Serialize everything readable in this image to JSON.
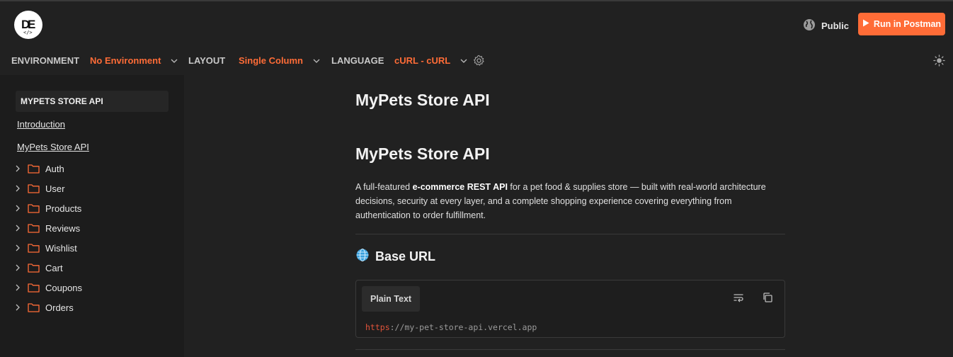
{
  "header": {
    "visibility_label": "Public",
    "run_button_label": "Run in Postman"
  },
  "toolbar": {
    "environment_label": "ENVIRONMENT",
    "environment_value": "No Environment",
    "layout_label": "LAYOUT",
    "layout_value": "Single Column",
    "language_label": "LANGUAGE",
    "language_value": "cURL - cURL"
  },
  "sidebar": {
    "title": "MYPETS STORE API",
    "links": [
      "Introduction",
      "MyPets Store API"
    ],
    "folders": [
      "Auth",
      "User",
      "Products",
      "Reviews",
      "Wishlist",
      "Cart",
      "Coupons",
      "Orders"
    ]
  },
  "main": {
    "page_title": "MyPets Store API",
    "section_title": "MyPets Store API",
    "description": {
      "part1": "A full-featured ",
      "bold": "e-commerce REST API",
      "part2": " for a pet food & supplies store — built with real-world architecture decisions, security at every layer, and a complete shopping experience covering everything from authentication to order fulfillment."
    },
    "base_url_heading": "Base URL",
    "code": {
      "lang_label": "Plain Text",
      "url_protocol": "https",
      "url_rest": "://my-pet-store-api.vercel.app"
    }
  },
  "colors": {
    "accent": "#ff6c37",
    "background": "#212121",
    "sidebar": "#1c1c1c"
  }
}
